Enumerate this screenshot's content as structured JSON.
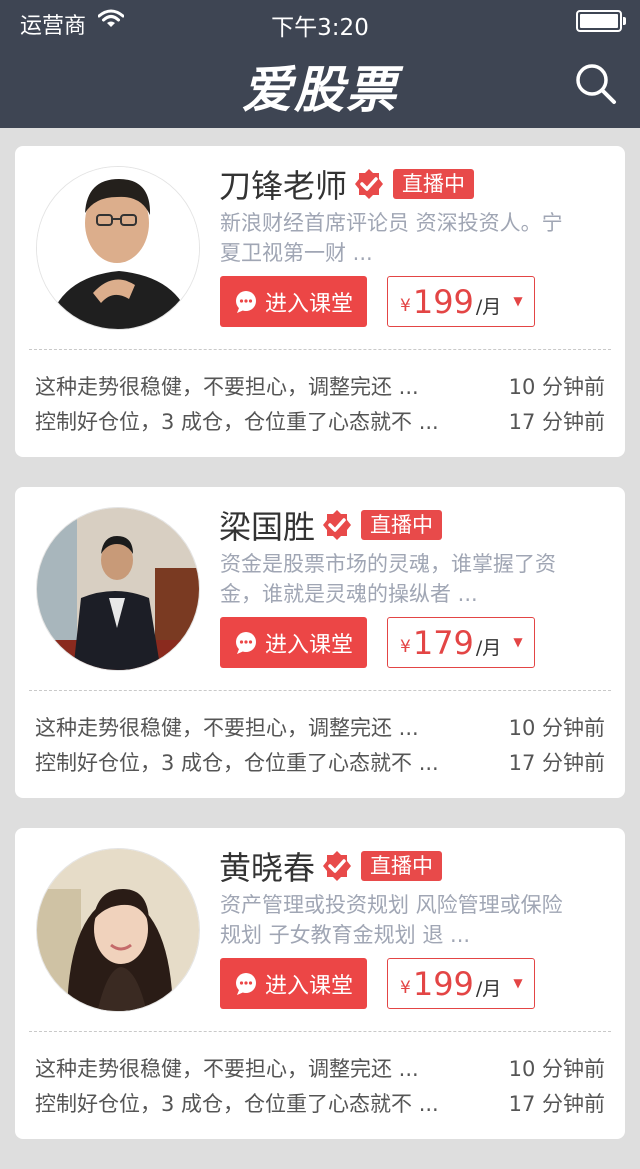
{
  "status_bar": {
    "carrier": "运营商",
    "time": "下午3:20"
  },
  "header": {
    "title": "爱股票",
    "search_icon": "search-icon"
  },
  "colors": {
    "nav_bg": "#3e4553",
    "accent": "#ec4646",
    "muted_text": "#a0a6b4"
  },
  "teachers": [
    {
      "name": "刀锋老师",
      "badge": "直播中",
      "desc": "新浪财经首席评论员 资深投资人。宁夏卫视第一财 ...",
      "enter_label": "进入课堂",
      "price": {
        "currency": "¥",
        "amount": "199",
        "unit": "/月"
      },
      "messages": [
        {
          "text": "这种走势很稳健，不要担心，调整完还 ...",
          "time": "10 分钟前"
        },
        {
          "text": "控制好仓位，3 成仓，仓位重了心态就不 ...",
          "time": "17 分钟前"
        }
      ]
    },
    {
      "name": "梁国胜",
      "badge": "直播中",
      "desc": "资金是股票市场的灵魂，谁掌握了资金，谁就是灵魂的操纵者 ...",
      "enter_label": "进入课堂",
      "price": {
        "currency": "¥",
        "amount": "179",
        "unit": "/月"
      },
      "messages": [
        {
          "text": "这种走势很稳健，不要担心，调整完还 ...",
          "time": "10 分钟前"
        },
        {
          "text": "控制好仓位，3 成仓，仓位重了心态就不 ...",
          "time": "17 分钟前"
        }
      ]
    },
    {
      "name": "黄晓春",
      "badge": "直播中",
      "desc": "资产管理或投资规划 风险管理或保险规划 子女教育金规划 退 ...",
      "enter_label": "进入课堂",
      "price": {
        "currency": "¥",
        "amount": "199",
        "unit": "/月"
      },
      "messages": [
        {
          "text": "这种走势很稳健，不要担心，调整完还 ...",
          "time": "10 分钟前"
        },
        {
          "text": "控制好仓位，3 成仓，仓位重了心态就不 ...",
          "time": "17 分钟前"
        }
      ]
    }
  ]
}
